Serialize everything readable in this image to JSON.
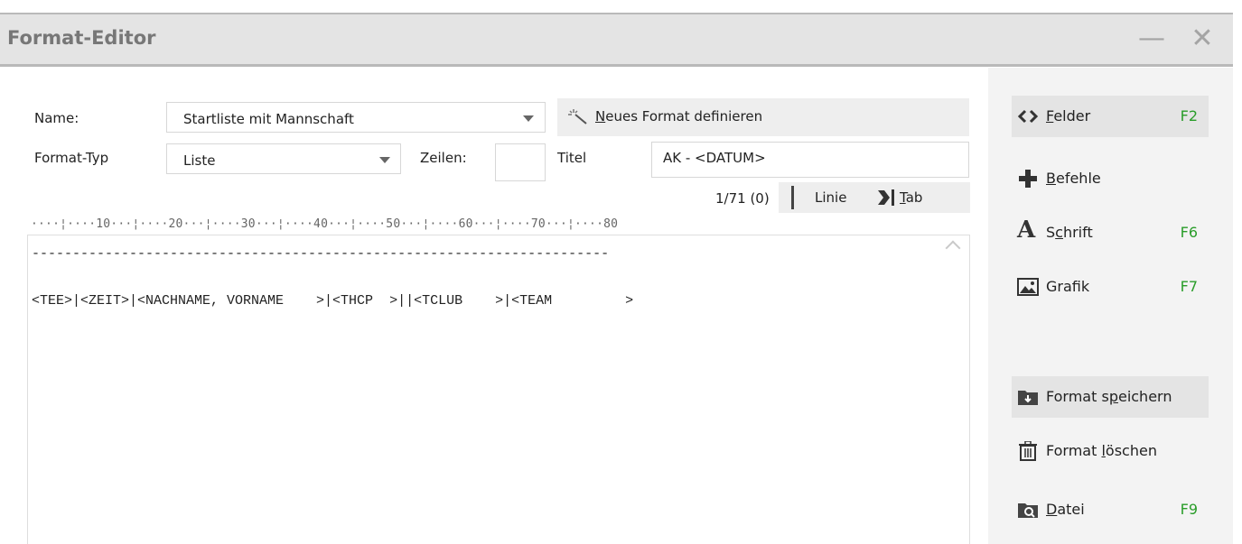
{
  "window": {
    "title": "Format-Editor",
    "minimize_symbol": "—",
    "close_symbol": "✕"
  },
  "form": {
    "name_label": "Name:",
    "name_value": "Startliste mit Mannschaft",
    "new_format_accel": "N",
    "new_format_rest": "eues Format definieren",
    "format_type_label": "Format-Typ",
    "format_type_value": "Liste",
    "lines_label": "Zeilen:",
    "lines_value": "",
    "title_label": "Titel",
    "title_value": "AK - <DATUM>"
  },
  "toolbar": {
    "position": "1/71 (0)",
    "line_label": "Linie",
    "tab_accel": "T",
    "tab_rest": "ab"
  },
  "ruler": "····¦····10···¦····20···¦····30···¦····40···¦····50···¦····60···¦····70···¦····80",
  "editor": {
    "lines": [
      "-----------------------------------------------------------------------",
      "",
      "<TEE>|<ZEIT>|<NACHNAME, VORNAME    >|<THCP  >||<TCLUB    >|<TEAM         >"
    ]
  },
  "sidebar": {
    "items": [
      {
        "pre": "",
        "accel": "F",
        "post": "elder",
        "key": "F2",
        "icon": "code-brackets-icon"
      },
      {
        "pre": "",
        "accel": "B",
        "post": "efehle",
        "key": "",
        "icon": "plus-icon"
      },
      {
        "pre": "S",
        "accel": "c",
        "post": "hrift",
        "key": "F6",
        "icon": "font-a-icon"
      },
      {
        "pre": "Grafik",
        "accel": "",
        "post": "",
        "key": "F7",
        "icon": "image-icon"
      },
      {
        "pre": "Format s",
        "accel": "p",
        "post": "eichern",
        "key": "",
        "icon": "folder-save-icon"
      },
      {
        "pre": "Format ",
        "accel": "l",
        "post": "öschen",
        "key": "",
        "icon": "trash-icon"
      },
      {
        "pre": "",
        "accel": "D",
        "post": "atei",
        "key": "F9",
        "icon": "folder-search-icon"
      }
    ]
  },
  "colors": {
    "accent_key": "#2a9d2a",
    "titlebar_bg": "#e4e4e4",
    "sidebar_bg": "#f3f3f3"
  }
}
